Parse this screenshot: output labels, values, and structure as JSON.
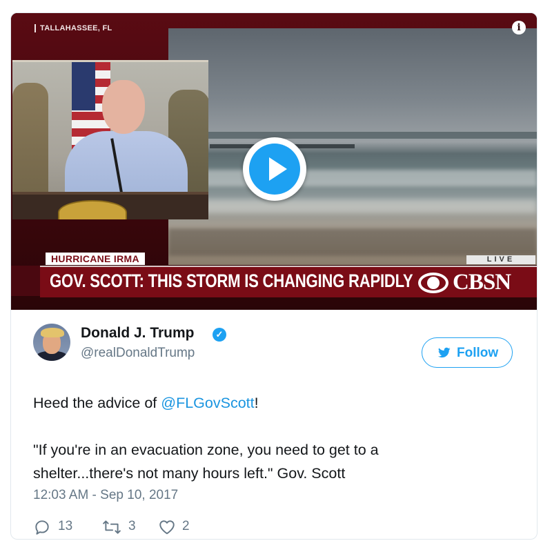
{
  "video": {
    "location_label": "TALLAHASSEE, FL",
    "info_icon": "info-icon",
    "play_icon": "play-icon",
    "tag_label": "HURRICANE IRMA",
    "headline": "GOV. SCOTT: THIS STORM IS CHANGING RAPIDLY",
    "live_label": "LIVE",
    "network": "CBSN",
    "accent_color": "#7a0c16"
  },
  "tweet": {
    "author_name": "Donald J. Trump",
    "handle": "@realDonaldTrump",
    "verified_icon": "verified-badge-icon",
    "follow_label": "Follow",
    "text_prefix": "Heed the advice of ",
    "mention": "@FLGovScott",
    "text_suffix": "!",
    "quote_line1": "\"If you're in an evacuation zone, you need to get to a",
    "quote_line2": "shelter...there's not many hours left.\" Gov. Scott",
    "timestamp": "12:03 AM - Sep 10, 2017",
    "replies": "13",
    "retweets": "3",
    "likes": "2",
    "brand_color": "#1da1f2"
  }
}
